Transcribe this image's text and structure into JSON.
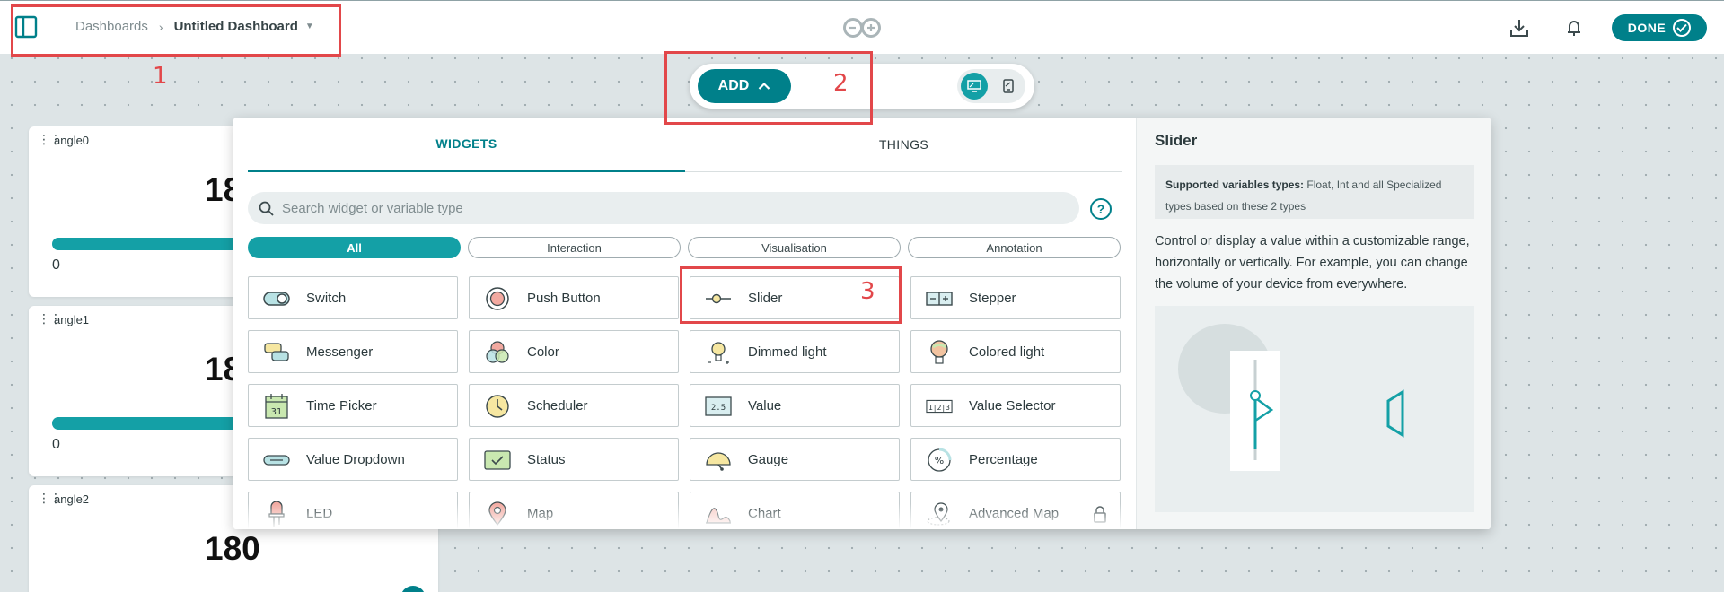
{
  "header": {
    "breadcrumb_root": "Dashboards",
    "breadcrumb_current": "Untitled Dashboard",
    "done_label": "DONE",
    "icons": [
      "sidebar-toggle-icon",
      "arduino-logo",
      "download-icon",
      "notification-bell-icon",
      "check-circle-icon"
    ]
  },
  "toolbar": {
    "add_label": "ADD",
    "view_modes": [
      "desktop-view",
      "mobile-view"
    ]
  },
  "annotations": [
    "1",
    "2",
    "3"
  ],
  "cards": [
    {
      "title": "angle0",
      "value": "18",
      "min": "0",
      "level_percent": 100
    },
    {
      "title": "angle1",
      "value": "18",
      "min": "0",
      "level_percent": 100
    },
    {
      "title": "angle2",
      "value": "180"
    }
  ],
  "panel": {
    "tabs": [
      "WIDGETS",
      "THINGS"
    ],
    "active_tab": "WIDGETS",
    "search_placeholder": "Search widget or variable type",
    "filters": [
      "All",
      "Interaction",
      "Visualisation",
      "Annotation"
    ],
    "active_filter": "All",
    "widgets": [
      {
        "label": "Switch",
        "icon": "switch-icon"
      },
      {
        "label": "Push Button",
        "icon": "push-button-icon"
      },
      {
        "label": "Slider",
        "icon": "slider-icon"
      },
      {
        "label": "Stepper",
        "icon": "stepper-icon"
      },
      {
        "label": "Messenger",
        "icon": "messenger-icon"
      },
      {
        "label": "Color",
        "icon": "color-icon"
      },
      {
        "label": "Dimmed light",
        "icon": "dimmed-light-icon"
      },
      {
        "label": "Colored light",
        "icon": "colored-light-icon"
      },
      {
        "label": "Time Picker",
        "icon": "time-picker-icon",
        "icon_text": "31"
      },
      {
        "label": "Scheduler",
        "icon": "scheduler-icon"
      },
      {
        "label": "Value",
        "icon": "value-icon",
        "icon_text": "2.5"
      },
      {
        "label": "Value Selector",
        "icon": "value-selector-icon",
        "icon_text": "1|2|3"
      },
      {
        "label": "Value Dropdown",
        "icon": "value-dropdown-icon"
      },
      {
        "label": "Status",
        "icon": "status-icon"
      },
      {
        "label": "Gauge",
        "icon": "gauge-icon"
      },
      {
        "label": "Percentage",
        "icon": "percentage-icon",
        "icon_text": "%"
      },
      {
        "label": "LED",
        "icon": "led-icon"
      },
      {
        "label": "Map",
        "icon": "map-icon"
      },
      {
        "label": "Chart",
        "icon": "chart-icon"
      },
      {
        "label": "Advanced Map",
        "icon": "advanced-map-icon",
        "locked": true
      }
    ]
  },
  "detail": {
    "title": "Slider",
    "supported_label": "Supported variables types:",
    "supported_text": " Float, Int and all Specialized types based on these 2 types",
    "description": "Control or display a value within a customizable range, horizontally or vertically. For example, you can change the volume of your device from everywhere."
  },
  "colors": {
    "accent": "#00808a",
    "accent_light": "#14a0a6",
    "annotation": "#e2474a",
    "canvas": "#dde4e6"
  }
}
